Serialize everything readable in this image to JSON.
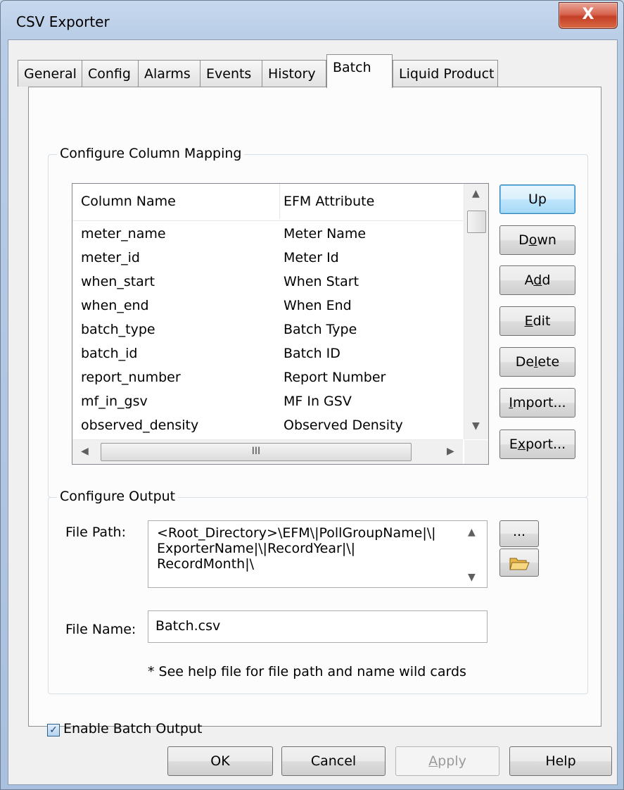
{
  "window": {
    "title": "CSV Exporter",
    "close_label": "X"
  },
  "tabs": [
    {
      "label": "General"
    },
    {
      "label": "Config"
    },
    {
      "label": "Alarms"
    },
    {
      "label": "Events"
    },
    {
      "label": "History"
    },
    {
      "label": "Batch",
      "active": true
    },
    {
      "label": "Liquid Product"
    }
  ],
  "column_mapping": {
    "group_label": "Configure Column Mapping",
    "headers": [
      "Column Name",
      "EFM Attribute"
    ],
    "rows": [
      [
        "meter_name",
        "Meter Name"
      ],
      [
        "meter_id",
        "Meter Id"
      ],
      [
        "when_start",
        "When Start"
      ],
      [
        "when_end",
        "When End"
      ],
      [
        "batch_type",
        "Batch Type"
      ],
      [
        "batch_id",
        "Batch ID"
      ],
      [
        "report_number",
        "Report Number"
      ],
      [
        "mf_in_gsv",
        "MF In GSV"
      ],
      [
        "observed_density",
        "Observed Density"
      ]
    ],
    "buttons": {
      "up": "Up",
      "down_pre": "D",
      "down_u": "o",
      "down_post": "wn",
      "add_pre": "A",
      "add_u": "d",
      "add_post": "d",
      "edit_pre": "",
      "edit_u": "E",
      "edit_post": "dit",
      "delete_pre": "De",
      "delete_u": "l",
      "delete_post": "ete",
      "import_pre": "",
      "import_u": "I",
      "import_post": "mport...",
      "export_pre": "E",
      "export_u": "x",
      "export_post": "port..."
    },
    "scroll_thumb_h": "III"
  },
  "output": {
    "group_label": "Configure Output",
    "file_path_label": "File Path:",
    "file_path_lines": [
      "<Root_Directory>\\EFM\\|PollGroupName|\\|",
      "ExporterName|\\|RecordYear|\\|",
      "RecordMonth|\\"
    ],
    "browse_label": "...",
    "folder_icon": "folder-open-icon",
    "file_name_label": "File Name:",
    "file_name_value": "Batch.csv",
    "help_note": "* See help file for file path and name wild cards"
  },
  "enable_output": {
    "label": "Enable Batch Output",
    "checked": true,
    "check_glyph": "✓"
  },
  "footer": {
    "ok": "OK",
    "cancel": "Cancel",
    "apply_pre": "",
    "apply_u": "A",
    "apply_post": "pply",
    "help": "Help"
  }
}
